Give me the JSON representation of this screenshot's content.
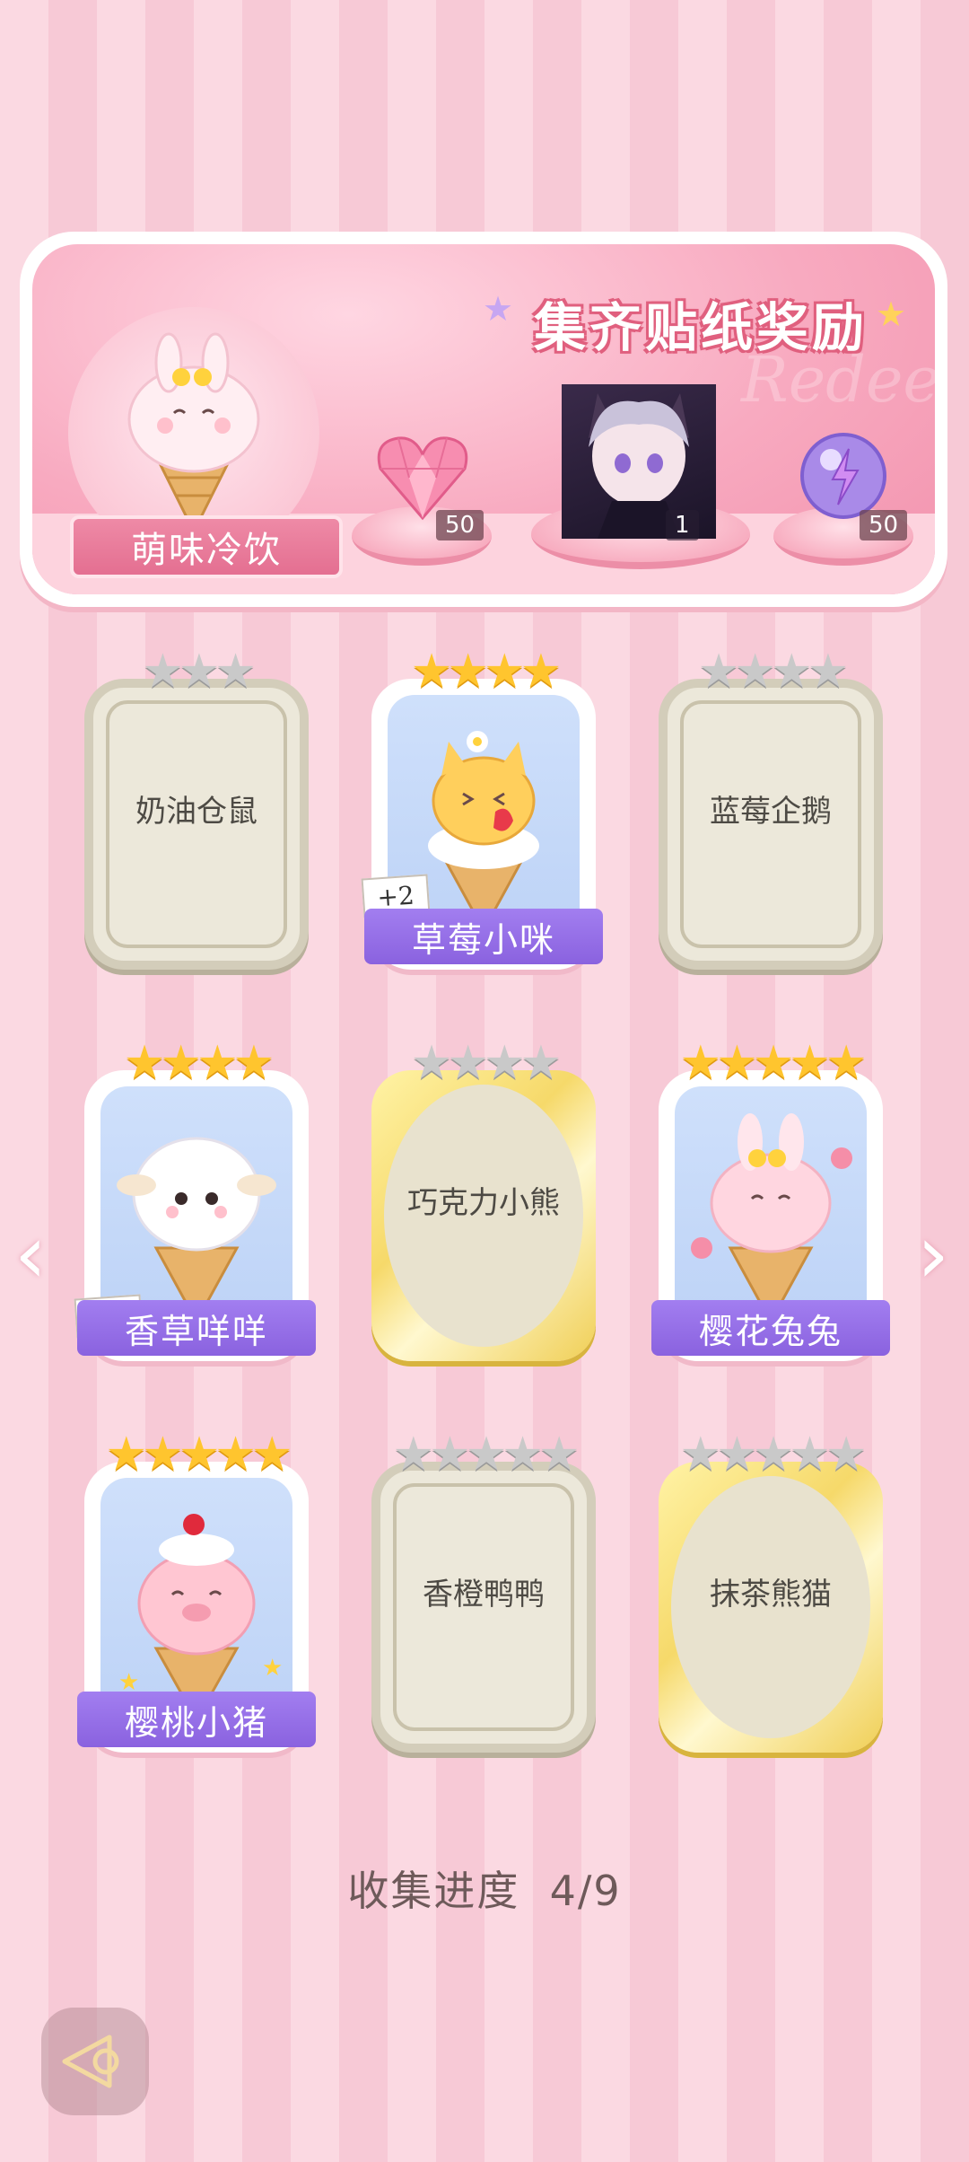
{
  "banner": {
    "title": "集齐贴纸奖励",
    "watermark": "Redeem",
    "theme_name": "萌味冷饮",
    "rewards": [
      {
        "icon": "pink-heart-gem-icon",
        "count": "50"
      },
      {
        "icon": "character-avatar-card",
        "count": "1"
      },
      {
        "icon": "purple-energy-orb-icon",
        "count": "50"
      }
    ]
  },
  "stickers": [
    {
      "name": "奶油仓鼠",
      "stars": 3,
      "filled": 0,
      "state": "locked-gray"
    },
    {
      "name": "草莓小咪",
      "stars": 4,
      "filled": 4,
      "state": "owned",
      "extra": "+2"
    },
    {
      "name": "蓝莓企鹅",
      "stars": 4,
      "filled": 0,
      "state": "locked-gray"
    },
    {
      "name": "香草咩咩",
      "stars": 4,
      "filled": 4,
      "state": "owned",
      "extra": "+3"
    },
    {
      "name": "巧克力小熊",
      "stars": 4,
      "filled": 0,
      "state": "locked-gold"
    },
    {
      "name": "樱花兔兔",
      "stars": 5,
      "filled": 5,
      "state": "owned"
    },
    {
      "name": "樱桃小猪",
      "stars": 5,
      "filled": 5,
      "state": "owned"
    },
    {
      "name": "香橙鸭鸭",
      "stars": 5,
      "filled": 0,
      "state": "locked-gray"
    },
    {
      "name": "抹茶熊猫",
      "stars": 5,
      "filled": 0,
      "state": "locked-gold"
    }
  ],
  "progress": {
    "label": "收集进度",
    "value": "4/9"
  },
  "colors": {
    "accent_pink": "#f292ad",
    "ribbon_purple": "#8a62df",
    "star_gold": "#ffc52e"
  }
}
